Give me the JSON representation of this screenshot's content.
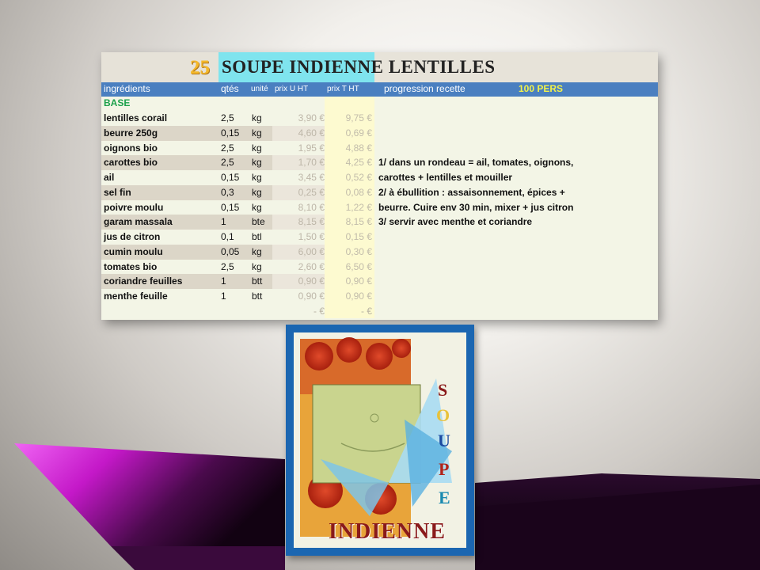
{
  "recipe": {
    "number": "25",
    "title": "SOUPE INDIENNE LENTILLES"
  },
  "headers": {
    "ingredients": "ingrédients",
    "qty": "qtés",
    "unit": "unité",
    "unit_price": "prix U HT",
    "total_price": "prix T HT",
    "progression": "progression recette",
    "servings": "100 PERS"
  },
  "section": "BASE",
  "ingredients": [
    {
      "name": "lentilles corail",
      "qty": "2,5",
      "unit": "kg",
      "pu": "3,90 €",
      "pt": "9,75 €"
    },
    {
      "name": "beurre 250g",
      "qty": "0,15",
      "unit": "kg",
      "pu": "4,60 €",
      "pt": "0,69 €"
    },
    {
      "name": "oignons bio",
      "qty": "2,5",
      "unit": "kg",
      "pu": "1,95 €",
      "pt": "4,88 €"
    },
    {
      "name": "carottes bio",
      "qty": "2,5",
      "unit": "kg",
      "pu": "1,70 €",
      "pt": "4,25 €"
    },
    {
      "name": "ail",
      "qty": "0,15",
      "unit": "kg",
      "pu": "3,45 €",
      "pt": "0,52 €"
    },
    {
      "name": "sel fin",
      "qty": "0,3",
      "unit": "kg",
      "pu": "0,25 €",
      "pt": "0,08 €"
    },
    {
      "name": "poivre moulu",
      "qty": "0,15",
      "unit": "kg",
      "pu": "8,10 €",
      "pt": "1,22 €"
    },
    {
      "name": "garam massala",
      "qty": "1",
      "unit": "bte",
      "pu": "8,15 €",
      "pt": "8,15 €"
    },
    {
      "name": "jus de citron",
      "qty": "0,1",
      "unit": "btl",
      "pu": "1,50 €",
      "pt": "0,15 €"
    },
    {
      "name": "cumin moulu",
      "qty": "0,05",
      "unit": "kg",
      "pu": "6,00 €",
      "pt": "0,30 €"
    },
    {
      "name": "tomates bio",
      "qty": "2,5",
      "unit": "kg",
      "pu": "2,60 €",
      "pt": "6,50 €"
    },
    {
      "name": "coriandre feuilles",
      "qty": "1",
      "unit": "btt",
      "pu": "0,90 €",
      "pt": "0,90 €"
    },
    {
      "name": "menthe feuille",
      "qty": "1",
      "unit": "btt",
      "pu": "0,90 €",
      "pt": "0,90 €"
    }
  ],
  "totals": {
    "pu": "-   €",
    "pt": "-   €"
  },
  "progression_lines": [
    "1/ dans un rondeau = ail, tomates, oignons,",
    "carottes + lentilles et mouiller",
    "2/ à ébullition : assaisonnement, épices +",
    "beurre. Cuire env 30 min, mixer + jus citron",
    "3/ servir avec menthe et coriandre"
  ],
  "poster": {
    "letters": [
      "S",
      "O",
      "U",
      "P",
      "E"
    ],
    "word": "INDIENNE"
  },
  "colors": {
    "header_blue": "#4a7fc0",
    "title_cyan": "#7fe4ee",
    "number_gold": "#f4b82a",
    "base_green": "#1aa04a",
    "servings_yellow": "#f2f24a",
    "poster_frame": "#1b66b1",
    "floor_magenta": "#d020d8"
  }
}
